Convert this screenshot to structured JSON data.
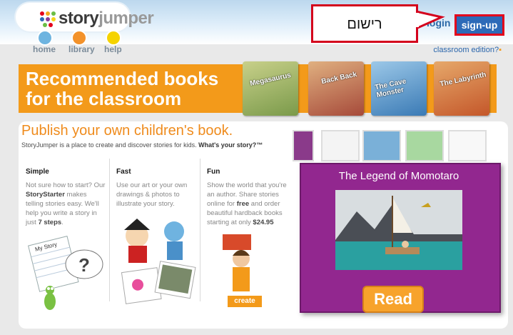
{
  "header": {
    "logo": {
      "part1": "story",
      "part2": "jumper",
      "dot_colors": [
        "#e3001b",
        "#f5a81c",
        "#6bbd45",
        "#2d6ab8",
        "#8d3d97",
        "#f5d41c"
      ]
    },
    "nav": [
      {
        "label": "home",
        "color": "#6eb4e0"
      },
      {
        "label": "library",
        "color": "#f3922a"
      },
      {
        "label": "help",
        "color": "#f5d300"
      }
    ],
    "login_label": "login",
    "signup_label": "sign-up",
    "callout_text": "רישום",
    "classroom_link": "classroom edition?"
  },
  "banner": {
    "title_line1": "Recommended books",
    "title_line2": "for the classroom",
    "books": [
      {
        "label": "Megasaurus",
        "color": "#7a9a4a"
      },
      {
        "label": "Back Back",
        "color": "#a64a3a"
      },
      {
        "label": "The Cave Monster",
        "color": "#3a7ab5"
      },
      {
        "label": "The Labyrinth",
        "color": "#c4572a"
      }
    ]
  },
  "publish": {
    "title": "Publish your own children's book.",
    "subtitle_plain": "StoryJumper is a place to create and discover stories for kids.",
    "subtitle_bold": "What's your story?™"
  },
  "columns": [
    {
      "heading": "Simple",
      "t1": "Not sure how to start? Our ",
      "b1": "StoryStarter",
      "t2": " makes telling stories easy. We'll help you write a story in just ",
      "b2": "7 steps",
      "t3": "."
    },
    {
      "heading": "Fast",
      "text": "Use our art or your own drawings & photos to illustrate your story."
    },
    {
      "heading": "Fun",
      "t1": "Show the world that you're an author. Share stories online for ",
      "b1": "free",
      "t2": " and order beautiful hardback books starting at only ",
      "b2": "$24.95"
    }
  ],
  "illustration": {
    "notebook_label": "My Story"
  },
  "create_label": "create",
  "showcase": {
    "book_title": "The Legend of Momotaro",
    "read_label": "Read",
    "cover_color": "#92278f"
  }
}
